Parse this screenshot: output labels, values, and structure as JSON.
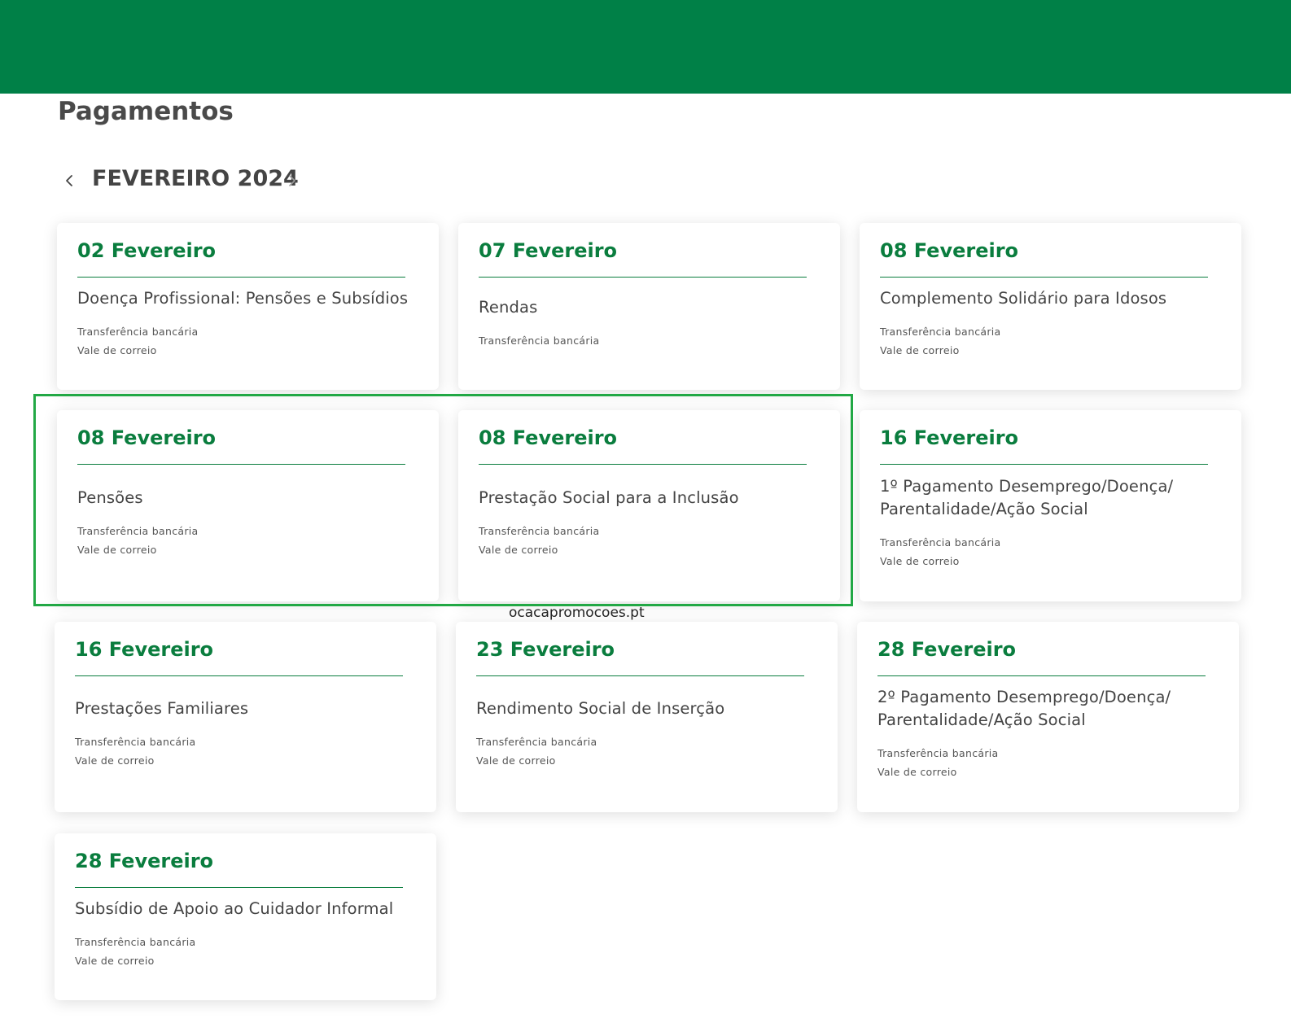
{
  "page": {
    "title": "Pagamentos",
    "month": "FEVEREIRO 2024",
    "prev_icon": "chevron-left-icon",
    "next_icon": "chevron-right-icon"
  },
  "colors": {
    "brand": "#008047",
    "date_accent": "#0a7d3e",
    "highlight": "#22a845"
  },
  "cards": [
    {
      "date": "02 Fevereiro",
      "name": "Doença Profissional: Pensões e Subsídios",
      "methods": [
        "Transferência bancária",
        "Vale de correio"
      ]
    },
    {
      "date": "07 Fevereiro",
      "name": "Rendas",
      "methods": [
        "Transferência bancária"
      ]
    },
    {
      "date": "08 Fevereiro",
      "name": "Complemento Solidário para Idosos",
      "methods": [
        "Transferência bancária",
        "Vale de correio"
      ]
    },
    {
      "date": "08 Fevereiro",
      "name": "Pensões",
      "methods": [
        "Transferência bancária",
        "Vale de correio"
      ]
    },
    {
      "date": "08 Fevereiro",
      "name": "Prestação Social para a Inclusão",
      "methods": [
        "Transferência bancária",
        "Vale de correio"
      ]
    },
    {
      "date": "16 Fevereiro",
      "name": "1º Pagamento Desemprego/Doença/ Parentalidade/Ação Social",
      "methods": [
        "Transferência bancária",
        "Vale de correio"
      ]
    },
    {
      "date": "16 Fevereiro",
      "name": "Prestações Familiares",
      "methods": [
        "Transferência bancária",
        "Vale de correio"
      ]
    },
    {
      "date": "23 Fevereiro",
      "name": "Rendimento Social de Inserção",
      "methods": [
        "Transferência bancária",
        "Vale de correio"
      ]
    },
    {
      "date": "28 Fevereiro",
      "name": "2º Pagamento Desemprego/Doença/ Parentalidade/Ação Social",
      "methods": [
        "Transferência bancária",
        "Vale de correio"
      ]
    },
    {
      "date": "28 Fevereiro",
      "name": "Subsídio de Apoio ao Cuidador Informal",
      "methods": [
        "Transferência bancária",
        "Vale de correio"
      ]
    }
  ],
  "watermark": "ocacapromocoes.pt"
}
